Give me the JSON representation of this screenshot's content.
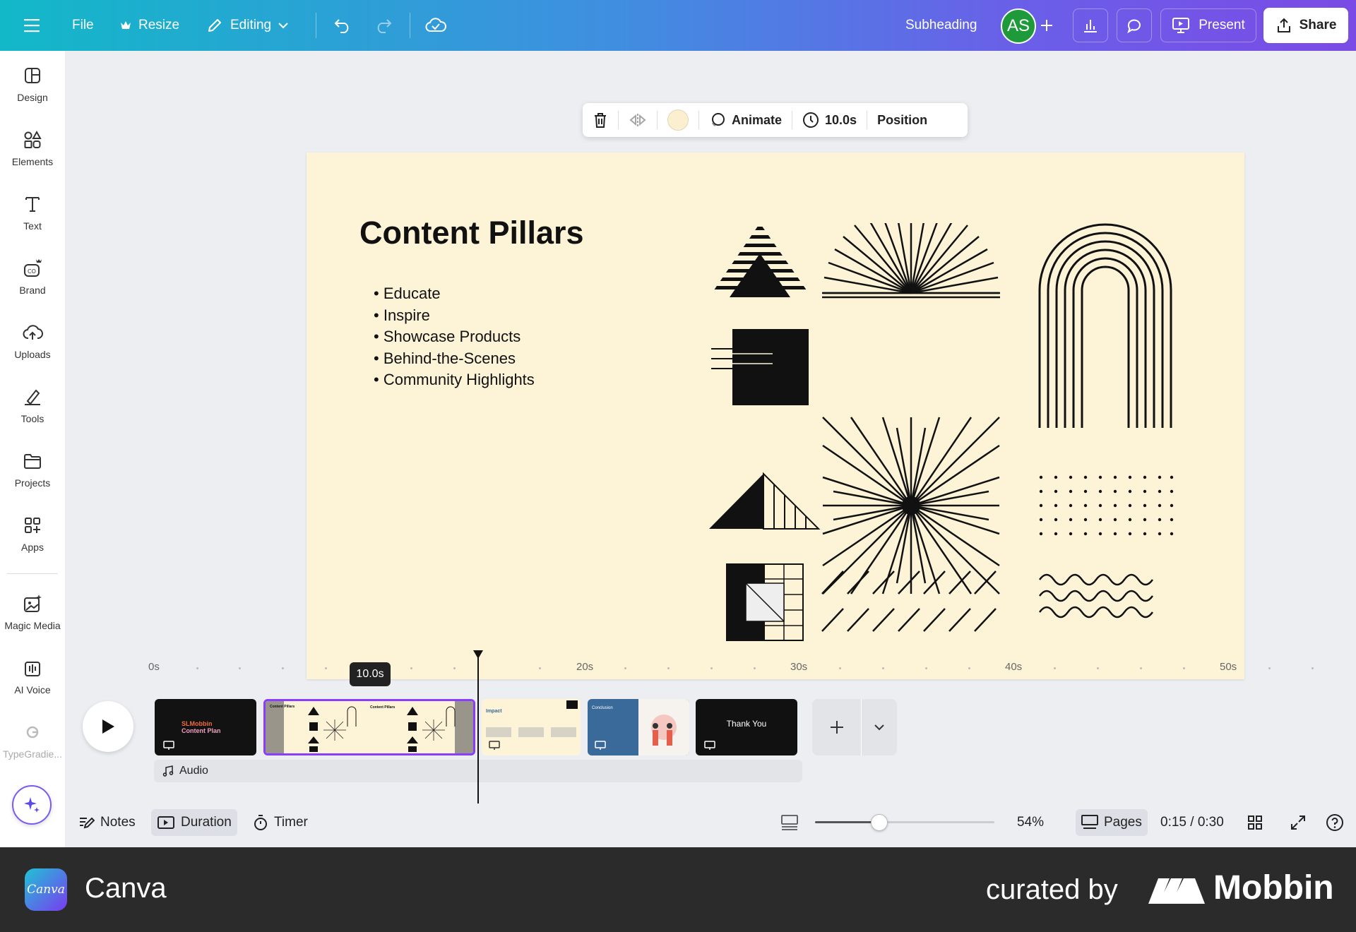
{
  "topbar": {
    "menu_icon": "hamburger-icon",
    "file": "File",
    "resize": "Resize",
    "editing": "Editing",
    "subheading": "Subheading",
    "avatar_initials": "AS",
    "present": "Present",
    "share": "Share"
  },
  "sidebar": {
    "items": [
      {
        "label": "Design",
        "icon": "design-icon"
      },
      {
        "label": "Elements",
        "icon": "elements-icon"
      },
      {
        "label": "Text",
        "icon": "text-icon"
      },
      {
        "label": "Brand",
        "icon": "brand-icon"
      },
      {
        "label": "Uploads",
        "icon": "uploads-icon"
      },
      {
        "label": "Tools",
        "icon": "tools-icon"
      },
      {
        "label": "Projects",
        "icon": "projects-icon"
      },
      {
        "label": "Apps",
        "icon": "apps-icon"
      },
      {
        "label": "Magic Media",
        "icon": "magic-media-icon"
      },
      {
        "label": "AI Voice",
        "icon": "ai-voice-icon"
      },
      {
        "label": "TypeGradie...",
        "icon": "typegradient-icon"
      }
    ]
  },
  "context_toolbar": {
    "animate": "Animate",
    "duration": "10.0s",
    "position": "Position",
    "color": "#fbefcf"
  },
  "slide": {
    "title": "Content Pillars",
    "bullets": [
      "Educate",
      "Inspire",
      "Showcase Products",
      "Behind-the-Scenes",
      "Community Highlights"
    ],
    "background": "#fdf4d8"
  },
  "timeline": {
    "ruler": [
      "0s",
      "10s",
      "20s",
      "30s",
      "40s",
      "50s"
    ],
    "tooltip": "10.0s",
    "thumbs": [
      {
        "title": "SLMobbin",
        "subtitle": "Content Plan"
      },
      {
        "title": "Content Pillars"
      },
      {
        "title": "Impact"
      },
      {
        "title": "Conclusion"
      },
      {
        "title": "Thank You"
      }
    ],
    "audio": "Audio"
  },
  "bottombar": {
    "notes": "Notes",
    "duration": "Duration",
    "timer": "Timer",
    "zoom": "54%",
    "zoom_level": 0.54,
    "pages": "Pages",
    "time": "0:15 / 0:30"
  },
  "footer": {
    "app_name": "Canva",
    "logo_text": "Canva",
    "curated_by": "curated by",
    "brand": "Mobbin"
  }
}
